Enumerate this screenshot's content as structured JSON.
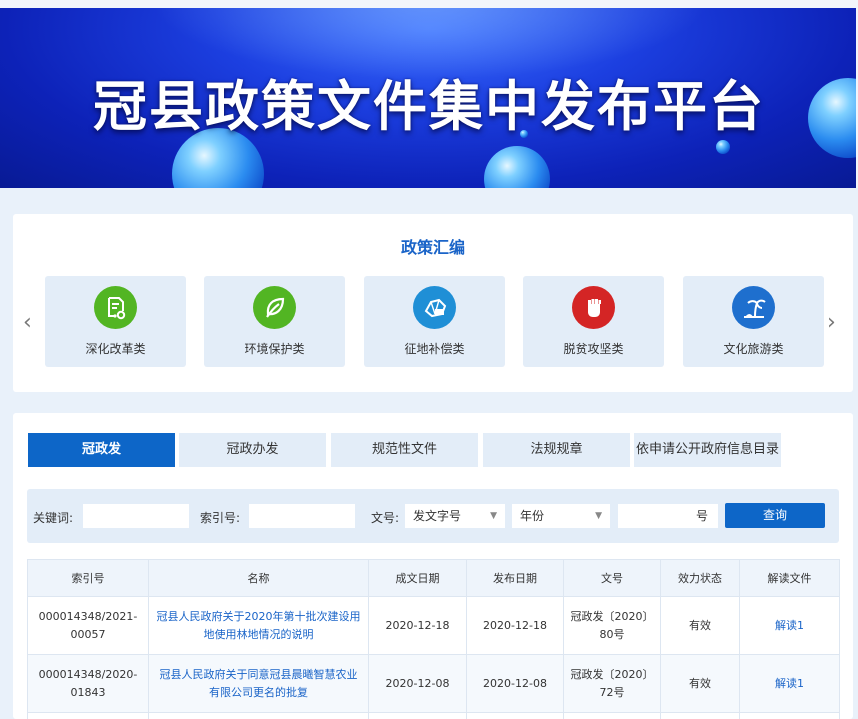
{
  "banner": {
    "title": "冠县政策文件集中发布平台"
  },
  "policy": {
    "title": "政策汇编",
    "categories": [
      {
        "label": "深化改革类",
        "icon": "document-reform-icon",
        "color": "#52b523"
      },
      {
        "label": "环境保护类",
        "icon": "leaf-icon",
        "color": "#52b523"
      },
      {
        "label": "征地补偿类",
        "icon": "land-map-icon",
        "color": "#1f8fd6"
      },
      {
        "label": "脱贫攻坚类",
        "icon": "fist-icon",
        "color": "#d42525"
      },
      {
        "label": "文化旅游类",
        "icon": "beach-palm-icon",
        "color": "#1e6fce"
      }
    ],
    "prev_arrow": "‹",
    "next_arrow": "›"
  },
  "tabs": [
    {
      "label": "冠政发",
      "active": true
    },
    {
      "label": "冠政办发",
      "active": false
    },
    {
      "label": "规范性文件",
      "active": false
    },
    {
      "label": "法规规章",
      "active": false
    },
    {
      "label": "依申请公开政府信息目录",
      "active": false
    }
  ],
  "search": {
    "keyword_label": "关键词:",
    "keyword_value": "",
    "index_label": "索引号:",
    "index_value": "",
    "docno_label": "文号:",
    "prefix_select": "发文字号",
    "year_select": "年份",
    "number_value": "",
    "number_suffix": "号",
    "submit_label": "查询"
  },
  "table": {
    "headers": [
      "索引号",
      "名称",
      "成文日期",
      "发布日期",
      "文号",
      "效力状态",
      "解读文件"
    ],
    "rows": [
      {
        "index": "000014348/2021-00057",
        "name": "冠县人民政府关于2020年第十批次建设用地使用林地情况的说明",
        "written": "2020-12-18",
        "published": "2020-12-18",
        "docno": "冠政发〔2020〕80号",
        "status": "有效",
        "interpret": "解读1"
      },
      {
        "index": "000014348/2020-01843",
        "name": "冠县人民政府关于同意冠县晨曦智慧农业有限公司更名的批复",
        "written": "2020-12-08",
        "published": "2020-12-08",
        "docno": "冠政发〔2020〕72号",
        "status": "有效",
        "interpret": "解读1"
      }
    ]
  },
  "colors": {
    "accent": "#0d66c8",
    "link": "#1a64c8",
    "tab_bg": "#e3edf8"
  }
}
